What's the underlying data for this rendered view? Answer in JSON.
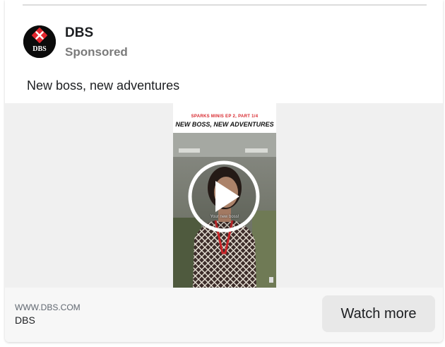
{
  "ad": {
    "brand": "DBS",
    "sponsored_label": "Sponsored",
    "caption": "New boss, new adventures",
    "avatar": {
      "icon": "dbs-logo-icon",
      "logo_text": "DBS",
      "accent": "#e3262e"
    },
    "video": {
      "episode_label": "SPARKS MINIS EP 2, PART 1/4",
      "episode_title": "NEW BOSS, NEW ADVENTURES",
      "subtitle": "Your new boss!",
      "play_icon": "play-icon"
    },
    "footer": {
      "domain": "WWW.DBS.COM",
      "brand": "DBS",
      "cta_label": "Watch more"
    }
  },
  "colors": {
    "text_primary": "#1c1e21",
    "text_secondary": "#7a7a7a",
    "media_background": "#f0f0f0",
    "footer_background": "#f7f7f7",
    "button_background": "#e8e8e8"
  }
}
